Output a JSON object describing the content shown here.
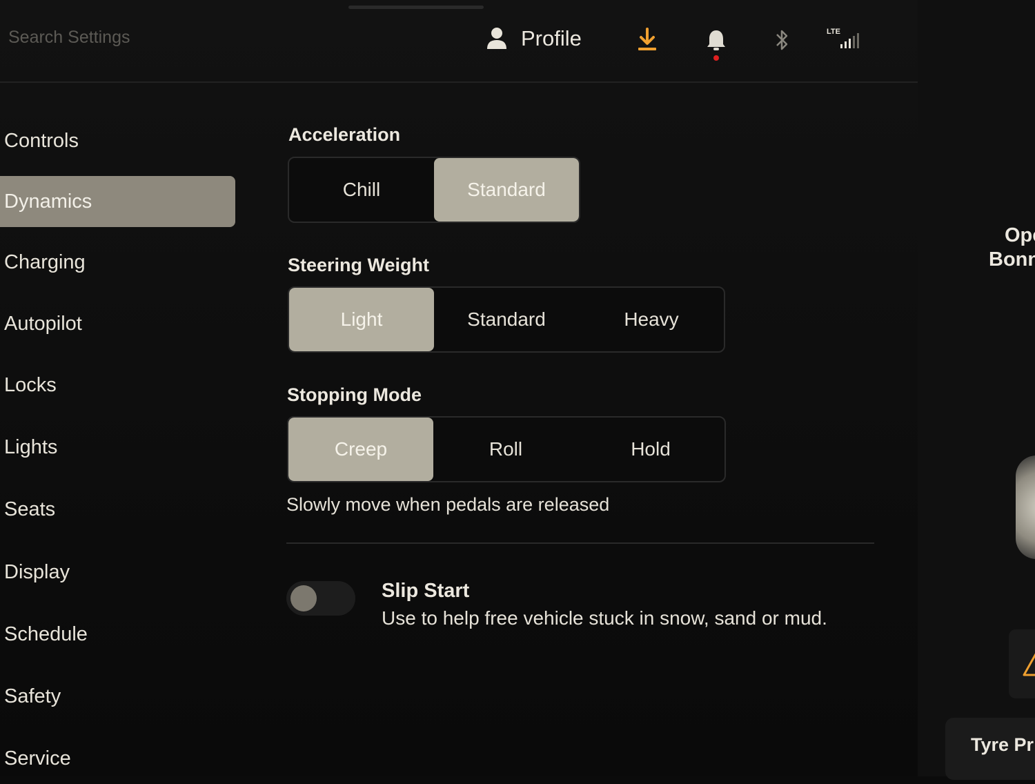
{
  "header": {
    "search_placeholder": "Search Settings",
    "profile_label": "Profile",
    "lte_label": "LTE",
    "download_color": "#f0a030",
    "notification_dot_color": "#e02020"
  },
  "sidebar": {
    "items": [
      {
        "label": "Controls"
      },
      {
        "label": "Dynamics",
        "active": true
      },
      {
        "label": "Charging"
      },
      {
        "label": "Autopilot"
      },
      {
        "label": "Locks"
      },
      {
        "label": "Lights"
      },
      {
        "label": "Seats"
      },
      {
        "label": "Display"
      },
      {
        "label": "Schedule"
      },
      {
        "label": "Safety"
      },
      {
        "label": "Service"
      }
    ]
  },
  "acceleration": {
    "title": "Acceleration",
    "options": [
      "Chill",
      "Standard"
    ],
    "selected": "Standard"
  },
  "steering": {
    "title": "Steering Weight",
    "options": [
      "Light",
      "Standard",
      "Heavy"
    ],
    "selected": "Light"
  },
  "stopping": {
    "title": "Stopping Mode",
    "options": [
      "Creep",
      "Roll",
      "Hold"
    ],
    "selected": "Creep",
    "description": "Slowly move when pedals are released"
  },
  "slip_start": {
    "title": "Slip Start",
    "description": "Use to help free vehicle stuck in snow, sand or mud.",
    "enabled": false
  },
  "right_panel": {
    "line1": "Ope",
    "line2": "Bonn",
    "tyre_label": "Tyre Pr",
    "warning_color": "#f0a030"
  }
}
